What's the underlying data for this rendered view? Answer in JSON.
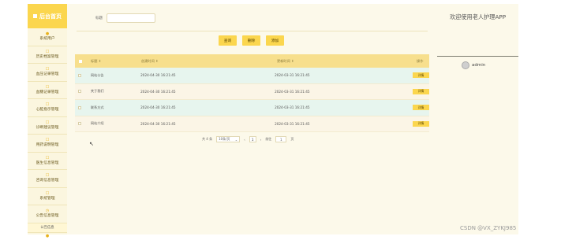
{
  "sidebar": {
    "brand": "后台首页",
    "items": [
      {
        "label": "系统用户",
        "icon": "user-icon"
      },
      {
        "label": "历史档案管理",
        "icon": "file-icon"
      },
      {
        "label": "血压记录管理",
        "icon": "file-icon"
      },
      {
        "label": "血糖记录管理",
        "icon": "file-icon"
      },
      {
        "label": "心脏指示管理",
        "icon": "file-icon"
      },
      {
        "label": "诊断建议管理",
        "icon": "file-icon"
      },
      {
        "label": "用药说明管理",
        "icon": "file-icon"
      },
      {
        "label": "医生信息管理",
        "icon": "file-icon"
      },
      {
        "label": "咨询信息管理",
        "icon": "file-icon"
      },
      {
        "label": "系统管理",
        "icon": "file-icon"
      },
      {
        "label": "公告信息管理",
        "icon": "clock-icon"
      }
    ],
    "sub_item": "公告信息"
  },
  "search": {
    "label": "标题",
    "value": "",
    "placeholder": ""
  },
  "buttons": {
    "query": "查询",
    "delete": "删除",
    "add": "添加"
  },
  "table": {
    "headers": {
      "title": "标题 ↕",
      "created": "创建时间 ↕",
      "updated": "更新时间 ↕",
      "action": "操作"
    },
    "rows": [
      {
        "title": "网站公告",
        "created": "2024-04-30 16:21:45",
        "updated": "2024-03-31 16:21:45",
        "action": "详情"
      },
      {
        "title": "关于我们",
        "created": "2024-04-30 16:21:45",
        "updated": "2024-03-31 16:21:45",
        "action": "详情"
      },
      {
        "title": "联系方式",
        "created": "2024-04-30 16:21:45",
        "updated": "2024-03-31 16:21:45",
        "action": "详情"
      },
      {
        "title": "网站介绍",
        "created": "2024-04-30 16:21:45",
        "updated": "2024-03-31 16:21:45",
        "action": "详情"
      }
    ]
  },
  "pagination": {
    "total": "共 4 条",
    "page_size": "10条/页",
    "prev": "‹",
    "current": "1",
    "next": "›",
    "goto_label": "前往",
    "goto_value": "1",
    "page_unit": "页"
  },
  "right_panel": {
    "welcome": "欢迎使用老人护理APP",
    "username": "admin"
  },
  "watermark": "CSDN @VX_ZYKJ985",
  "colors": {
    "accent": "#fbd64e",
    "sidebar_bg": "#fbf6df",
    "row_green": "#e7f5ee",
    "row_cream": "#fbf5e6"
  }
}
